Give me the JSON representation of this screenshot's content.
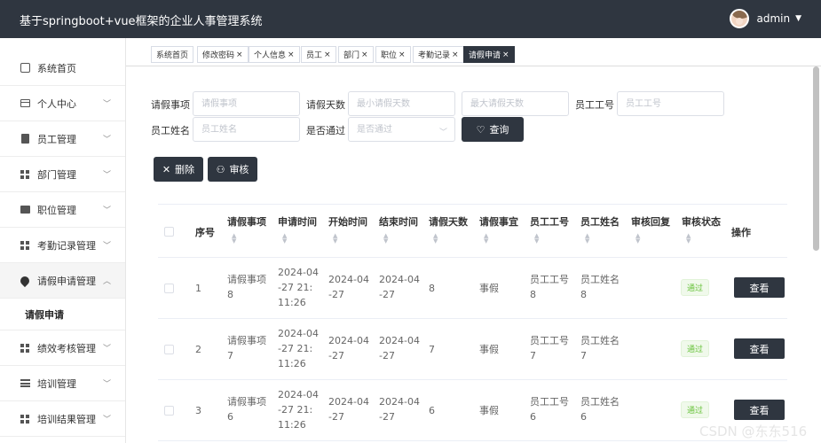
{
  "header": {
    "title": "基于springboot+vue框架的企业人事管理系统",
    "username": "admin"
  },
  "sidebar": {
    "items": [
      {
        "label": "系统首页",
        "icon": "home-icon"
      },
      {
        "label": "个人中心",
        "icon": "id-card-icon"
      },
      {
        "label": "员工管理",
        "icon": "document-icon"
      },
      {
        "label": "部门管理",
        "icon": "grid-icon"
      },
      {
        "label": "职位管理",
        "icon": "monitor-icon"
      },
      {
        "label": "考勤记录管理",
        "icon": "grid-icon"
      },
      {
        "label": "请假申请管理",
        "icon": "location-pin-icon"
      },
      {
        "label": "绩效考核管理",
        "icon": "grid-icon"
      },
      {
        "label": "培训管理",
        "icon": "list-icon"
      },
      {
        "label": "培训结果管理",
        "icon": "grid-icon"
      }
    ],
    "sub_item": "请假申请"
  },
  "tabs": [
    "系统首页",
    "修改密码",
    "个人信息",
    "员工",
    "部门",
    "职位",
    "考勤记录",
    "请假申请"
  ],
  "search": {
    "leave_item_label": "请假事项",
    "leave_item_placeholder": "请假事项",
    "days_label": "请假天数",
    "min_days_placeholder": "最小请假天数",
    "max_days_placeholder": "最大请假天数",
    "emp_no_label": "员工工号",
    "emp_no_placeholder": "员工工号",
    "emp_name_label": "员工姓名",
    "emp_name_placeholder": "员工姓名",
    "approved_label": "是否通过",
    "approved_placeholder": "是否通过",
    "query_button": "查询"
  },
  "actions": {
    "delete": "删除",
    "review": "审核"
  },
  "table": {
    "headers": [
      "序号",
      "请假事项",
      "申请时间",
      "开始时间",
      "结束时间",
      "请假天数",
      "请假事宜",
      "员工工号",
      "员工姓名",
      "审核回复",
      "审核状态",
      "操作"
    ],
    "rows": [
      {
        "no": "1",
        "item": "请假事项8",
        "apply": "2024-04-27 21:11:26",
        "start": "2024-04-27",
        "end": "2024-04-27",
        "days": "8",
        "matter": "事假",
        "emp_no": "员工工号8",
        "emp_name": "员工姓名8",
        "reply": "",
        "status": "通过",
        "action": "查看"
      },
      {
        "no": "2",
        "item": "请假事项7",
        "apply": "2024-04-27 21:11:26",
        "start": "2024-04-27",
        "end": "2024-04-27",
        "days": "7",
        "matter": "事假",
        "emp_no": "员工工号7",
        "emp_name": "员工姓名7",
        "reply": "",
        "status": "通过",
        "action": "查看"
      },
      {
        "no": "3",
        "item": "请假事项6",
        "apply": "2024-04-27 21:11:26",
        "start": "2024-04-27",
        "end": "2024-04-27",
        "days": "6",
        "matter": "事假",
        "emp_no": "员工工号6",
        "emp_name": "员工姓名6",
        "reply": "",
        "status": "通过",
        "action": "查看"
      }
    ]
  },
  "watermark": "CSDN @东东516",
  "colors": {
    "header_bg": "#2f3640",
    "primary_button": "#2f3640",
    "status_ok": "#67c23a"
  }
}
